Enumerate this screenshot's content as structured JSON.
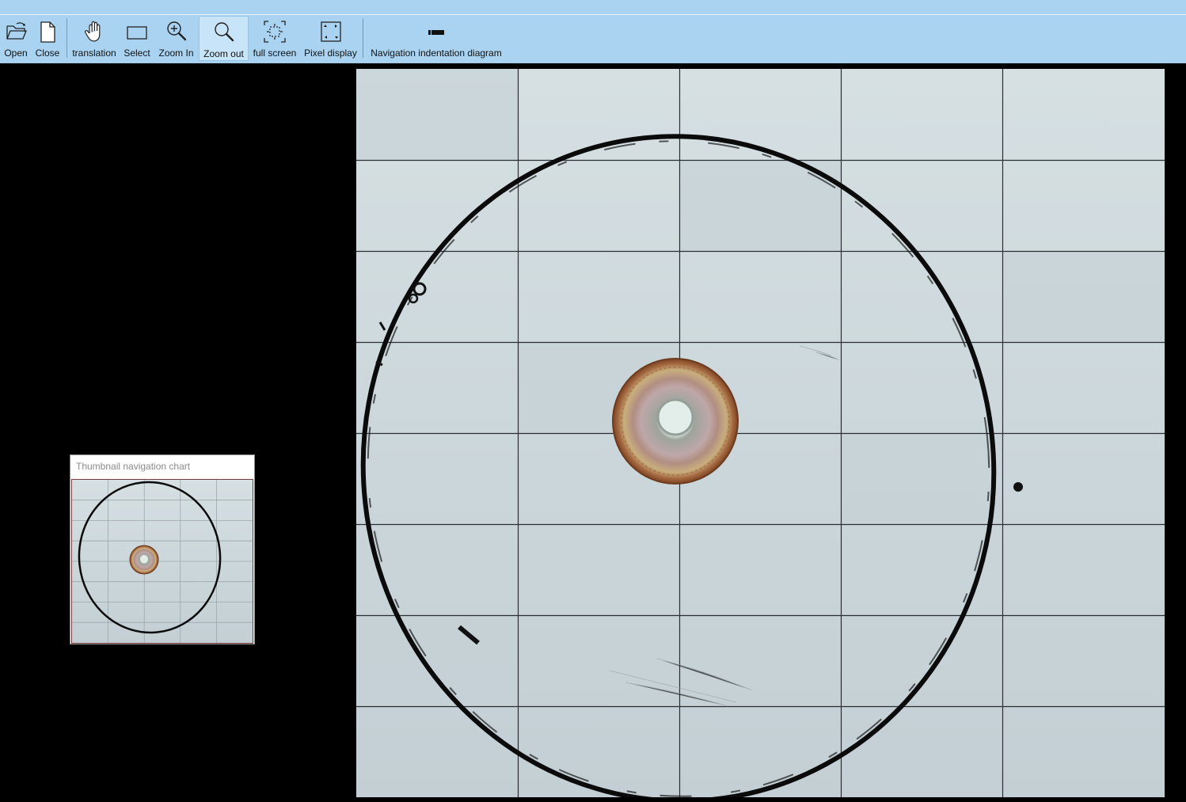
{
  "toolbar": {
    "buttons": [
      {
        "label": "Open",
        "icon": "open-folder-icon"
      },
      {
        "label": "Close",
        "icon": "document-icon"
      },
      {
        "label": "translation",
        "icon": "hand-pan-icon"
      },
      {
        "label": "Select",
        "icon": "rectangle-select-icon"
      },
      {
        "label": "Zoom In",
        "icon": "zoom-in-icon"
      },
      {
        "label": "Zoom out",
        "icon": "zoom-out-icon",
        "active": true
      },
      {
        "label": "full screen",
        "icon": "full-screen-icon"
      },
      {
        "label": "Pixel display",
        "icon": "pixel-display-icon"
      },
      {
        "label": "Navigation indentation diagram",
        "icon": "navigation-diagram-icon"
      }
    ]
  },
  "thumbnail": {
    "title": "Thumbnail navigation chart"
  },
  "viewer": {
    "grid_columns": 5,
    "grid_rows": 8
  },
  "colors": {
    "toolbar_bg": "#a9d3f1",
    "active_button_bg": "#c8e4f8",
    "canvas_bg": "#000000",
    "image_tile_bg": "#cdd8dc",
    "ring_stroke": "#0b0b0b",
    "specimen_outer": "#a4683f",
    "specimen_inner": "#c7a88f"
  }
}
